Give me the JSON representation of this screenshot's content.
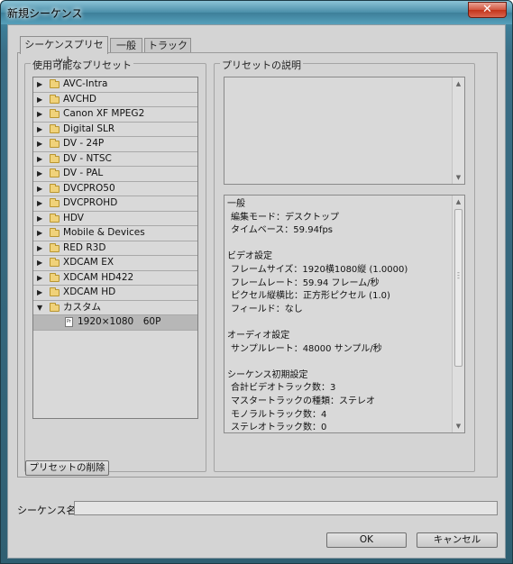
{
  "window": {
    "title": "新規シーケンス",
    "close_glyph": "✕"
  },
  "tabs": [
    {
      "label": "シーケンスプリセット",
      "active": true
    },
    {
      "label": "一般",
      "active": false
    },
    {
      "label": "トラック",
      "active": false
    }
  ],
  "presets": {
    "legend": "使用可能なプリセット",
    "items": [
      {
        "label": "AVC-Intra",
        "expanded": false
      },
      {
        "label": "AVCHD",
        "expanded": false
      },
      {
        "label": "Canon XF MPEG2",
        "expanded": false
      },
      {
        "label": "Digital SLR",
        "expanded": false
      },
      {
        "label": "DV - 24P",
        "expanded": false
      },
      {
        "label": "DV - NTSC",
        "expanded": false
      },
      {
        "label": "DV - PAL",
        "expanded": false
      },
      {
        "label": "DVCPRO50",
        "expanded": false
      },
      {
        "label": "DVCPROHD",
        "expanded": false
      },
      {
        "label": "HDV",
        "expanded": false
      },
      {
        "label": "Mobile & Devices",
        "expanded": false
      },
      {
        "label": "RED R3D",
        "expanded": false
      },
      {
        "label": "XDCAM EX",
        "expanded": false
      },
      {
        "label": "XDCAM HD422",
        "expanded": false
      },
      {
        "label": "XDCAM HD",
        "expanded": false
      },
      {
        "label": "カスタム",
        "expanded": true
      }
    ],
    "child": {
      "label": "1920×1080　60P",
      "icon_text": "Pr",
      "selected": true
    }
  },
  "description": {
    "legend": "プリセットの説明",
    "lines": [
      {
        "text": "一般",
        "indent": false
      },
      {
        "text": "編集モード：デスクトップ",
        "indent": true
      },
      {
        "text": "タイムベース：59.94fps",
        "indent": true
      },
      {
        "text": "",
        "indent": false
      },
      {
        "text": "ビデオ設定",
        "indent": false
      },
      {
        "text": "フレームサイズ：1920横1080縦 (1.0000)",
        "indent": true
      },
      {
        "text": "フレームレート：59.94 フレーム/秒",
        "indent": true
      },
      {
        "text": "ピクセル縦横比：正方形ピクセル (1.0)",
        "indent": true
      },
      {
        "text": "フィールド：なし",
        "indent": true
      },
      {
        "text": "",
        "indent": false
      },
      {
        "text": "オーディオ設定",
        "indent": false
      },
      {
        "text": "サンプルレート：48000 サンプル/秒",
        "indent": true
      },
      {
        "text": "",
        "indent": false
      },
      {
        "text": "シーケンス初期設定",
        "indent": false
      },
      {
        "text": "合計ビデオトラック数：3",
        "indent": true
      },
      {
        "text": "マスタートラックの種類：ステレオ",
        "indent": true
      },
      {
        "text": "モノラルトラック数：4",
        "indent": true
      },
      {
        "text": "ステレオトラック数：0",
        "indent": true
      }
    ]
  },
  "buttons": {
    "delete_preset": "プリセットの削除",
    "ok": "OK",
    "cancel": "キャンセル"
  },
  "sequence_name": {
    "label": "シーケンス名：",
    "value": ""
  }
}
